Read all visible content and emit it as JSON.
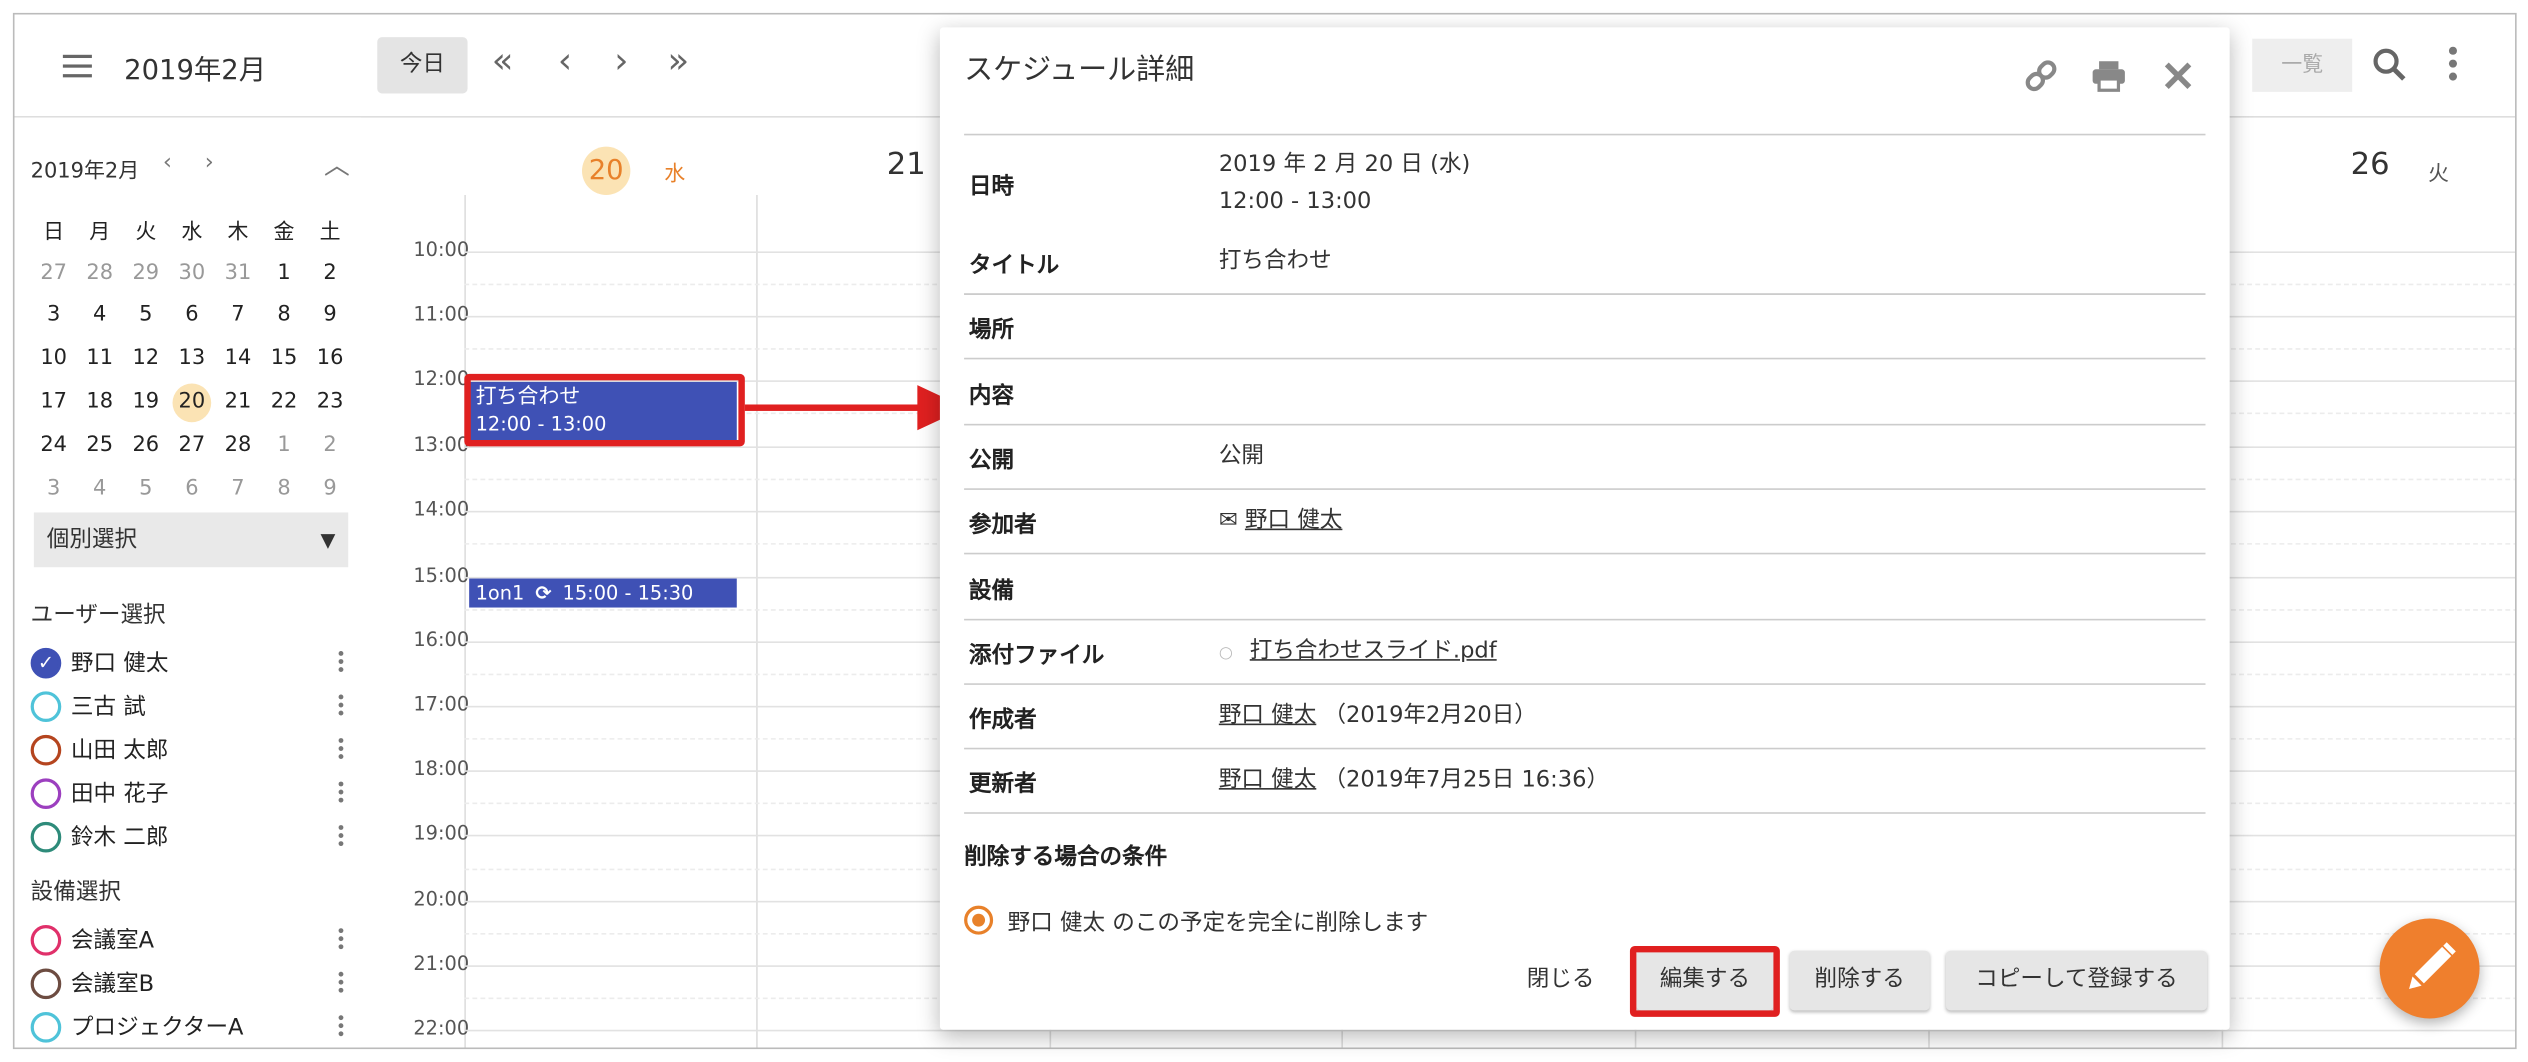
{
  "header": {
    "month_title": "2019年2月",
    "today_label": "今日",
    "list_label": "一覧"
  },
  "mini_calendar": {
    "title": "2019年2月",
    "weekdays": [
      "日",
      "月",
      "火",
      "水",
      "木",
      "金",
      "土"
    ],
    "weeks": [
      [
        "27",
        "28",
        "29",
        "30",
        "31",
        "1",
        "2"
      ],
      [
        "3",
        "4",
        "5",
        "6",
        "7",
        "8",
        "9"
      ],
      [
        "10",
        "11",
        "12",
        "13",
        "14",
        "15",
        "16"
      ],
      [
        "17",
        "18",
        "19",
        "20",
        "21",
        "22",
        "23"
      ],
      [
        "24",
        "25",
        "26",
        "27",
        "28",
        "1",
        "2"
      ],
      [
        "3",
        "4",
        "5",
        "6",
        "7",
        "8",
        "9"
      ]
    ],
    "today": "20"
  },
  "sidebar": {
    "select_value": "個別選択",
    "user_section_label": "ユーザー選択",
    "users": [
      {
        "name": "野口 健太",
        "color": "#3f51b5",
        "checked": true
      },
      {
        "name": "三古 試",
        "color": "#4fc3d9",
        "checked": false
      },
      {
        "name": "山田 太郎",
        "color": "#b5451f",
        "checked": false
      },
      {
        "name": "田中 花子",
        "color": "#9c3fbf",
        "checked": false
      },
      {
        "name": "鈴木 二郎",
        "color": "#2e8b7a",
        "checked": false
      }
    ],
    "facility_section_label": "設備選択",
    "facilities": [
      {
        "name": "会議室A",
        "color": "#e0306a"
      },
      {
        "name": "会議室B",
        "color": "#6d4c41"
      },
      {
        "name": "プロジェクターA",
        "color": "#4fc3d9"
      }
    ]
  },
  "calendar": {
    "days": [
      {
        "num": "20",
        "wk": "水",
        "today": true
      },
      {
        "num": "21",
        "wk": ""
      },
      {
        "num": "26",
        "wk": "火"
      }
    ],
    "times": [
      "10:00",
      "11:00",
      "12:00",
      "13:00",
      "14:00",
      "15:00",
      "16:00",
      "17:00",
      "18:00",
      "19:00",
      "20:00",
      "21:00",
      "22:00"
    ],
    "events": [
      {
        "title": "打ち合わせ",
        "time": "12:00 - 13:00"
      },
      {
        "title": "1on1",
        "time": "15:00 - 15:30",
        "repeat_icon": "sync-icon"
      }
    ]
  },
  "dialog": {
    "title": "スケジュール詳細",
    "icons": [
      "link-icon",
      "print-icon",
      "close-icon"
    ],
    "rows": [
      {
        "label": "日時",
        "value": "2019 年 2 月 20 日 (水)",
        "value2": "12:00 - 13:00"
      },
      {
        "label": "タイトル",
        "value": "打ち合わせ"
      },
      {
        "label": "場所",
        "value": ""
      },
      {
        "label": "内容",
        "value": ""
      },
      {
        "label": "公開",
        "value": "公開"
      },
      {
        "label": "参加者",
        "value": "野口 健太"
      },
      {
        "label": "設備",
        "value": ""
      },
      {
        "label": "添付ファイル",
        "value": "打ち合わせスライド.pdf"
      },
      {
        "label": "作成者",
        "value": "野口 健太",
        "note": "（2019年2月20日）"
      },
      {
        "label": "更新者",
        "value": "野口 健太",
        "note": "（2019年7月25日 16:36）"
      }
    ],
    "condition_title": "削除する場合の条件",
    "condition_option": "野口 健太 のこの予定を完全に削除します",
    "buttons": {
      "close": "閉じる",
      "edit": "編集する",
      "delete": "削除する",
      "copy": "コピーして登録する"
    }
  },
  "colors": {
    "accent": "#ef7f2d",
    "event": "#3f51b5",
    "highlight": "#e02020",
    "today_bg": "#fbe3b4"
  }
}
